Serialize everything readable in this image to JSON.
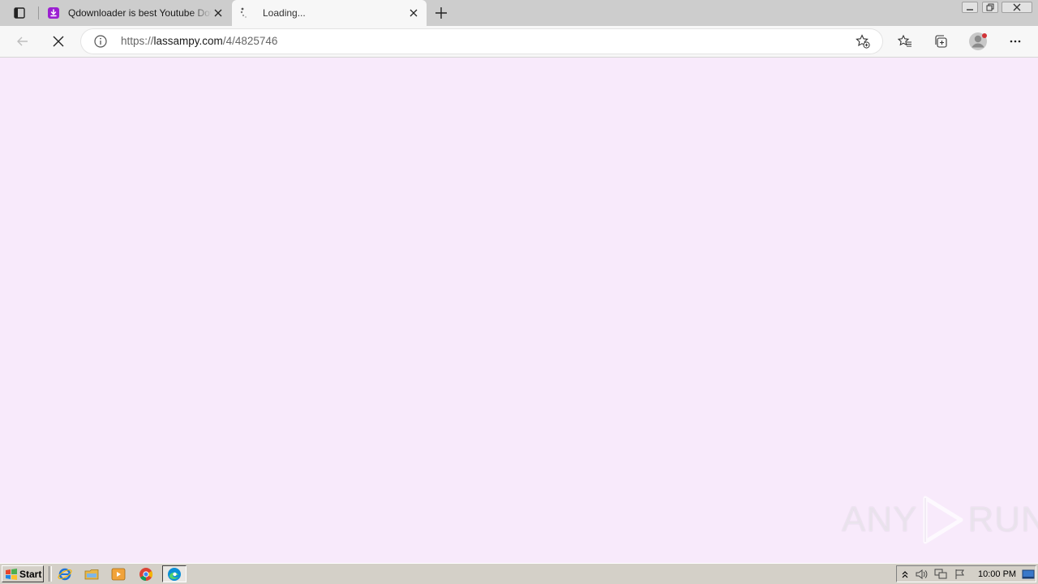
{
  "tabs": [
    {
      "title": "Qdownloader is best Youtube Downloader",
      "favicon": "qdownloader-favicon",
      "active": false
    },
    {
      "title": "Loading...",
      "favicon": "loading-spinner-icon",
      "active": true
    }
  ],
  "address_bar": {
    "scheme": "https://",
    "host": "lassampy.com",
    "path": "/4/4825746"
  },
  "page": {
    "background": "#f8eafb"
  },
  "watermark": {
    "left": "ANY",
    "right": "RUN"
  },
  "taskbar": {
    "start_label": "Start",
    "apps": [
      "internet-explorer-icon",
      "file-explorer-icon",
      "media-player-icon",
      "chrome-icon",
      "edge-icon"
    ],
    "clock": "10:00 PM"
  },
  "colors": {
    "accent_tab_icon": "#9b1fd1",
    "profile_dot": "#d13438"
  }
}
